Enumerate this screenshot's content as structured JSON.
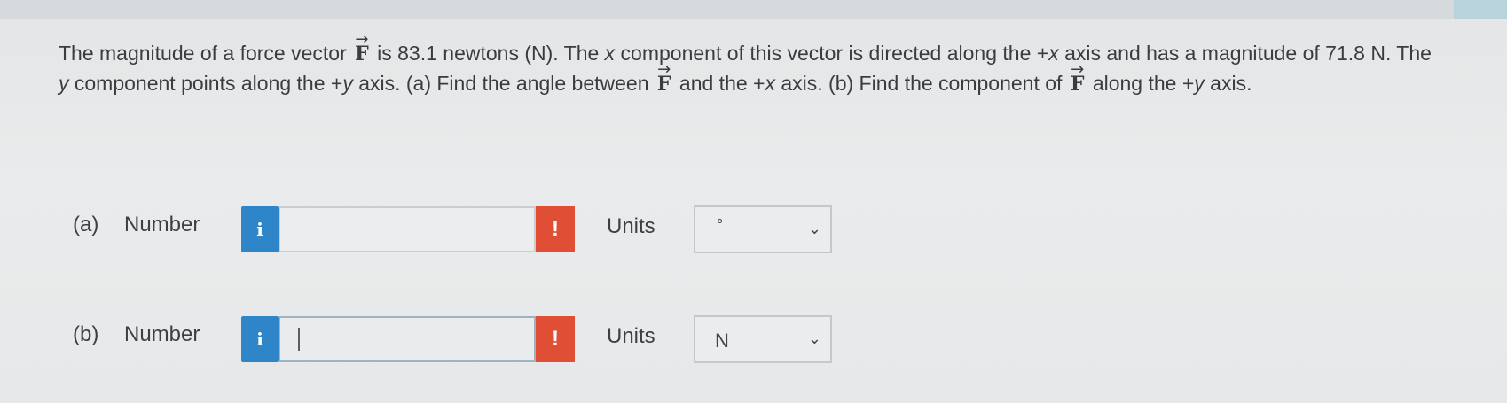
{
  "question": {
    "seg1": "The magnitude of a force vector ",
    "vec1": "F",
    "seg2": " is 83.1 newtons (N). The ",
    "var_x1": "x",
    "seg3": " component of this vector is directed along the +",
    "var_x2": "x",
    "seg4": " axis and has a magnitude of 71.8 N. The ",
    "var_y1": "y",
    "seg5": " component points along the +",
    "var_y2": "y",
    "seg6": " axis. (a) Find the angle between ",
    "vec2": "F",
    "seg7": " and the +",
    "var_x3": "x",
    "seg8": " axis. (b) Find the component of ",
    "vec3": "F",
    "seg9": " along the +",
    "var_y3": "y",
    "seg10": " axis."
  },
  "parts": [
    {
      "label": "(a)",
      "number_label": "Number",
      "info_icon": "i",
      "input_value": "",
      "warning_icon": "!",
      "units_label": "Units",
      "units_selected": "°"
    },
    {
      "label": "(b)",
      "number_label": "Number",
      "info_icon": "i",
      "input_value": "",
      "warning_icon": "!",
      "units_label": "Units",
      "units_selected": "N"
    }
  ],
  "icons": {
    "info": "info-icon",
    "warning": "warning-icon",
    "dropdown": "chevron-down-icon"
  },
  "colors": {
    "info_button": "#2e86c9",
    "warning_button": "#e04e36"
  }
}
